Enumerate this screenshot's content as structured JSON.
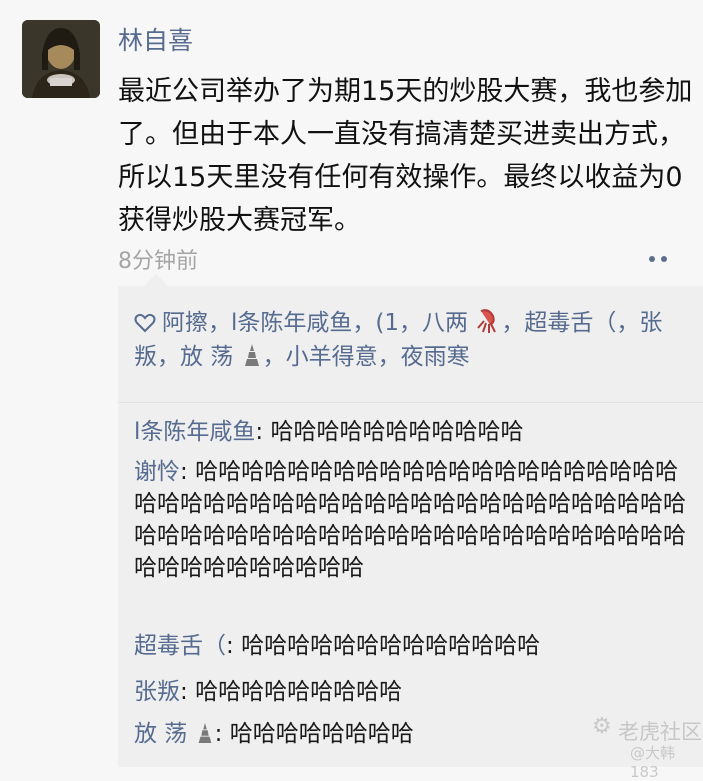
{
  "post": {
    "author": "林自喜",
    "content": "最近公司举办了为期15天的炒股大赛，我也参加了。但由于本人一直没有搞清楚买进卖出方式，所以15天里没有任何有效操作。最终以收益为0获得炒股大赛冠军。",
    "time": "8分钟前"
  },
  "likes": {
    "part1": "阿擦，l条陈年咸鱼，(1，八两",
    "part2": "，超毒舌（，张叛，放 荡",
    "part3": "，小羊得意，夜雨寒"
  },
  "comments": [
    {
      "name": "l条陈年咸鱼",
      "sep": ": ",
      "text": "哈哈哈哈哈哈哈哈哈哈哈"
    },
    {
      "name": "谢怜",
      "sep": ": ",
      "text": "哈哈哈哈哈哈哈哈哈哈哈哈哈哈哈哈哈哈哈哈哈哈哈哈哈哈哈哈哈哈哈哈哈哈哈哈哈哈哈哈哈哈哈哈哈哈哈哈哈哈哈哈哈哈哈哈哈哈哈哈哈哈哈哈哈哈哈哈哈哈哈哈哈哈哈哈哈哈哈"
    },
    {
      "name": "超毒舌（",
      "sep": ": ",
      "text": "哈哈哈哈哈哈哈哈哈哈哈哈哈"
    },
    {
      "name": "张叛",
      "sep": ": ",
      "text": "哈哈哈哈哈哈哈哈哈"
    },
    {
      "name": "放 荡",
      "sep": ": ",
      "text": "哈哈哈哈哈哈哈哈"
    }
  ],
  "watermark": {
    "main": "老虎社区",
    "sub": "@大韩183"
  },
  "colors": {
    "name": "#566b8f",
    "timestamp": "#a5a5a5",
    "comment_bg": "#efefef"
  },
  "icons": {
    "likes": "heart-outline-icon",
    "emoji1": "squid-emoji-icon",
    "emoji2": "tower-emoji-icon",
    "more": "more-dots-icon"
  }
}
